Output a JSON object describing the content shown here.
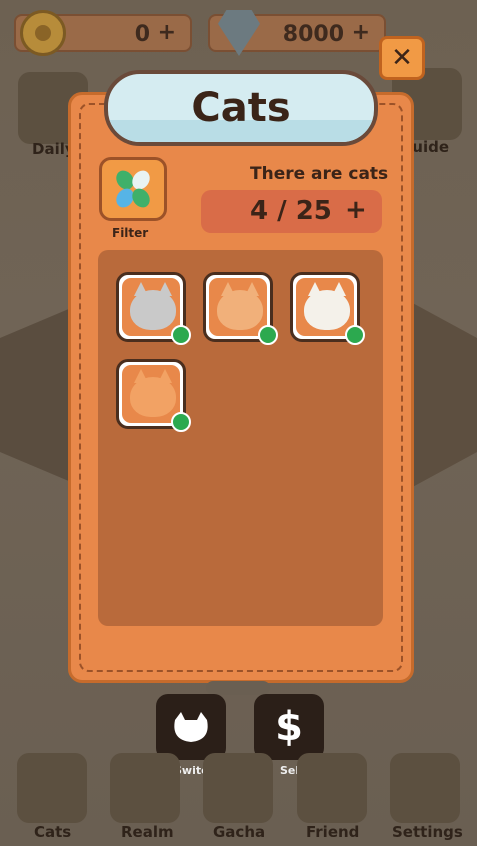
{
  "header": {
    "coins": "0",
    "coins_plus": "+",
    "gems": "8000",
    "gems_plus": "+"
  },
  "side": {
    "left_label": "Daily",
    "right_label": "Guide"
  },
  "dialog": {
    "title": "Cats",
    "close_glyph": "✕",
    "filter_label": "Filter",
    "count_label": "There are cats",
    "count_value": "4 / 25",
    "count_plus": "+",
    "cats": [
      {
        "name": "gray-tabby-cat",
        "color": "#c9c9c9"
      },
      {
        "name": "orange-calico-cat",
        "color": "#f1b07a"
      },
      {
        "name": "calico-cat",
        "color": "#f4f1ea"
      },
      {
        "name": "orange-tabby-cat",
        "color": "#f2a264"
      }
    ]
  },
  "actions": {
    "switch_label": "Switch",
    "sell_label": "Sell",
    "sell_glyph": "$"
  },
  "nav": {
    "cats": "Cats",
    "realm": "Realm",
    "gacha": "Gacha",
    "friend": "Friend",
    "settings": "Settings"
  }
}
